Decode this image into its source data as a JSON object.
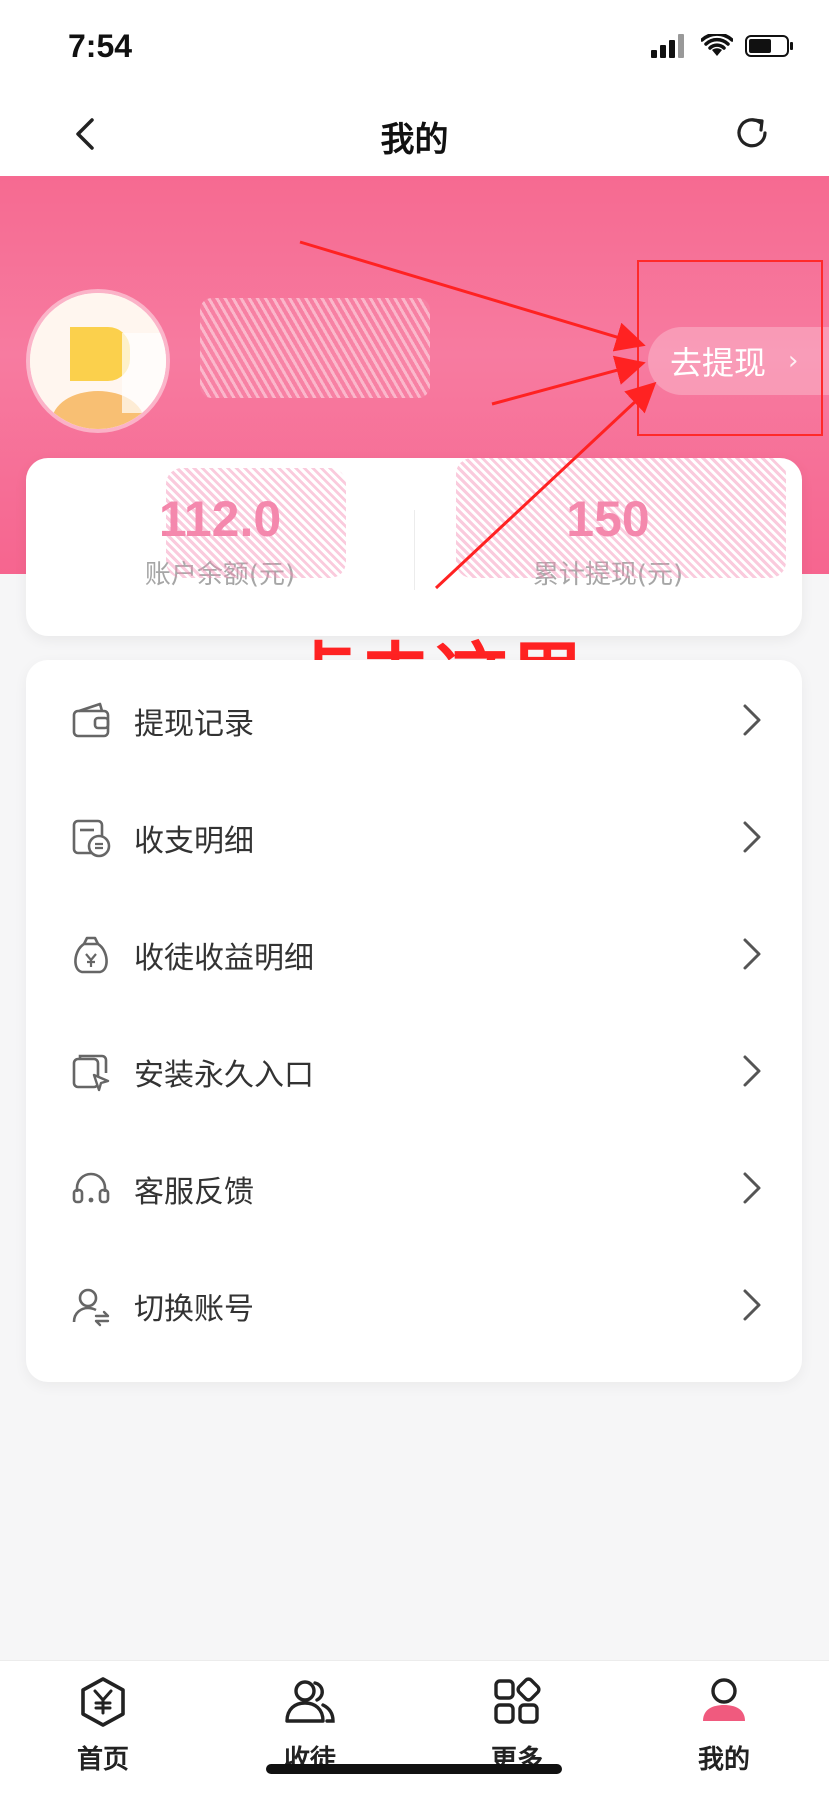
{
  "status_bar": {
    "time": "7:54"
  },
  "nav": {
    "title": "我的"
  },
  "profile": {
    "withdraw_label": "去提现"
  },
  "stats": {
    "balance_value": "112.0",
    "balance_label": "账户余额(元)",
    "total_value": "150",
    "total_label": "累计提现(元)"
  },
  "annotation": {
    "text": "点击这里"
  },
  "menu": [
    {
      "label": "提现记录",
      "icon": "wallet-icon"
    },
    {
      "label": "收支明细",
      "icon": "bill-icon"
    },
    {
      "label": "收徒收益明细",
      "icon": "money-bag-icon"
    },
    {
      "label": "安装永久入口",
      "icon": "install-shortcut-icon"
    },
    {
      "label": "客服反馈",
      "icon": "headset-icon"
    },
    {
      "label": "切换账号",
      "icon": "switch-account-icon"
    }
  ],
  "tabs": [
    {
      "label": "首页",
      "icon": "yuan-hexagon-icon"
    },
    {
      "label": "收徒",
      "icon": "users-icon"
    },
    {
      "label": "更多",
      "icon": "grid-icon"
    },
    {
      "label": "我的",
      "icon": "profile-icon"
    }
  ],
  "colors": {
    "accent": "#f66a91",
    "annotation": "#ff2222"
  }
}
